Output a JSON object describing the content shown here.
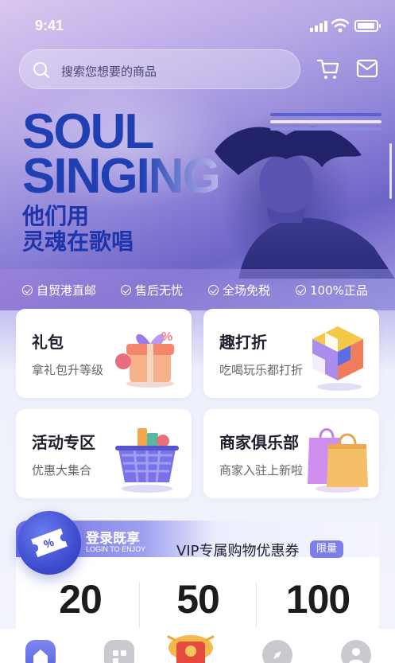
{
  "status_bar": {
    "time": "9:41"
  },
  "search": {
    "placeholder": "搜索您想要的商品"
  },
  "hero": {
    "title_line1": "SOUL",
    "title_line2": "SINGING",
    "subtitle_line1": "他们用",
    "subtitle_line2": "灵魂在歌唱"
  },
  "tags": [
    {
      "label": "自贸港直邮"
    },
    {
      "label": "售后无忧"
    },
    {
      "label": "全场免税"
    },
    {
      "label": "100%正品"
    }
  ],
  "cards": [
    {
      "title": "礼包",
      "subtitle": "拿礼包升等级",
      "icon": "gift-box-icon"
    },
    {
      "title": "趣打折",
      "subtitle": "吃喝玩乐都打折",
      "icon": "cube-icon"
    },
    {
      "title": "活动专区",
      "subtitle": "优惠大集合",
      "icon": "shopping-basket-icon"
    },
    {
      "title": "商家俱乐部",
      "subtitle": "商家入驻上新啦",
      "icon": "shopping-bags-icon"
    }
  ],
  "coupon": {
    "login_main": "登录既享",
    "login_sub": "LOGIN TO ENJOY",
    "title": "VIP专属购物优惠券",
    "badge": "限量",
    "amounts": [
      "20",
      "50",
      "100"
    ]
  },
  "tabbar": {
    "items": [
      {
        "icon": "home-icon",
        "active": true
      },
      {
        "icon": "category-icon",
        "active": false
      },
      {
        "icon": "red-envelope-gift-icon",
        "active": false
      },
      {
        "icon": "compass-icon",
        "active": false
      },
      {
        "icon": "user-icon",
        "active": false
      }
    ]
  },
  "colors": {
    "brand_blue": "#1f3fb3",
    "accent": "#7d7fe8",
    "tab_active": "#5a65e0"
  }
}
